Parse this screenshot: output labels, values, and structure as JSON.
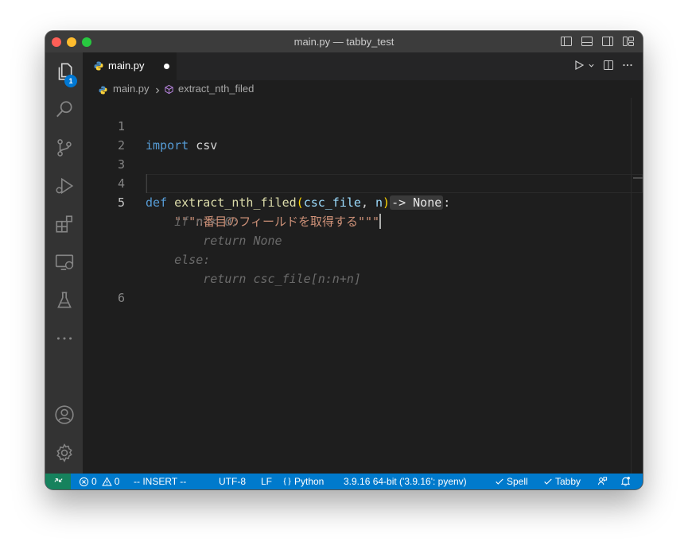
{
  "window": {
    "title": "main.py — tabby_test"
  },
  "activity": {
    "explorer_badge": "1"
  },
  "tab": {
    "label": "main.py"
  },
  "breadcrumb": {
    "file": "main.py",
    "symbol": "extract_nth_filed"
  },
  "editor": {
    "line_numbers": [
      "1",
      "2",
      "3",
      "4",
      "5",
      "6"
    ],
    "active_line": "5",
    "code": {
      "import_kw": "import",
      "import_mod": "csv",
      "def_kw": "def",
      "func_name": "extract_nth_filed",
      "paren_open": "(",
      "param1": "csc_file",
      "comma": ",",
      "param2": "n",
      "paren_close": ")",
      "return_hint": "-> None",
      "colon": ":",
      "docstring": "\"\"\"n番目のフィールドを取得する\"\"\"",
      "suggestion": [
        "    if n < 0:",
        "        return None",
        "    else:",
        "        return csc_file[n:n+n]"
      ]
    }
  },
  "status": {
    "errors": "0",
    "warnings": "0",
    "mode": "-- INSERT --",
    "encoding": "UTF-8",
    "eol": "LF",
    "language": "Python",
    "interpreter": "3.9.16 64-bit ('3.9.16': pyenv)",
    "spell": "Spell",
    "tabby": "Tabby"
  }
}
